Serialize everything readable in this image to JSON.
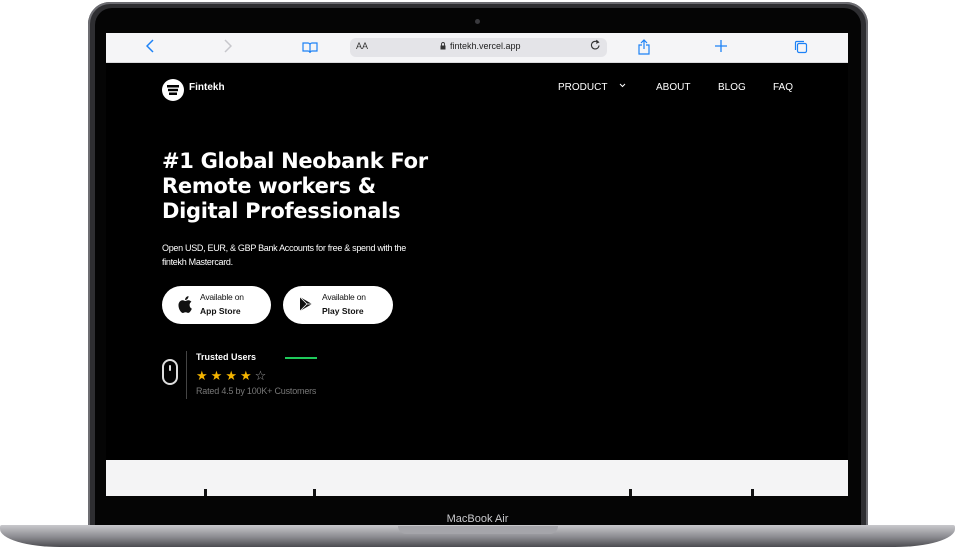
{
  "device": {
    "label": "MacBook Air"
  },
  "browser": {
    "reader_label": "AA",
    "url": "fintekh.vercel.app",
    "icons": [
      "chevron-left-icon",
      "chevron-right-icon",
      "book-icon",
      "lock-icon",
      "reload-icon",
      "share-icon",
      "plus-icon",
      "tabs-icon"
    ]
  },
  "site": {
    "brand": "Fintekh",
    "nav": {
      "product": "PRODUCT",
      "about": "ABOUT",
      "blog": "BLOG",
      "faq": "FAQ"
    },
    "hero": {
      "title_line1": "#1 Global Neobank For",
      "title_line2": "Remote workers &",
      "title_line3": "Digital Professionals",
      "subtitle_line1": "Open USD, EUR, & GBP Bank Accounts for free & spend with the",
      "subtitle_line2": "fintekh Mastercard."
    },
    "stores": {
      "app_store": {
        "small": "Available on",
        "big": "App Store"
      },
      "play_store": {
        "small": "Available on",
        "big": "Play Store"
      }
    },
    "trust": {
      "title": "Trusted Users",
      "rating_text": "Rated 4.5 by 100K+ Customers",
      "stars_filled": 4,
      "stars_total": 5,
      "accent_color": "#1fca5b",
      "star_color": "#f4b400"
    }
  }
}
